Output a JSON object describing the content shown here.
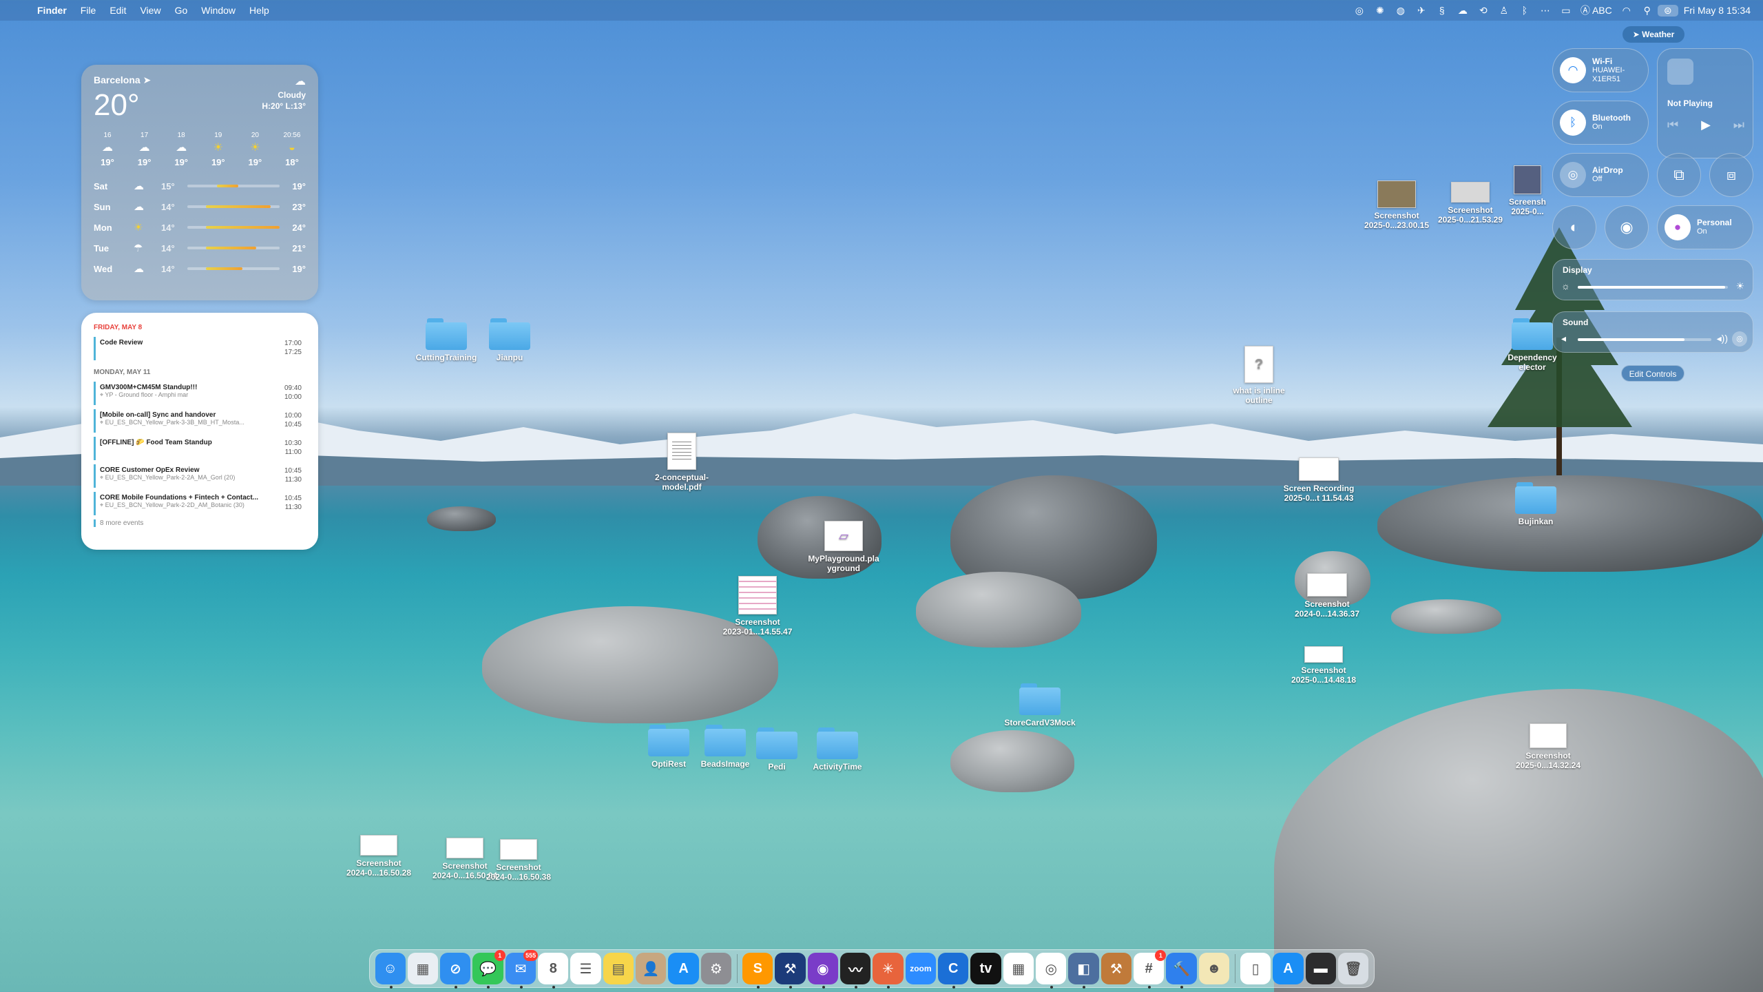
{
  "menubar": {
    "app_name": "Finder",
    "menus": [
      "File",
      "Edit",
      "View",
      "Go",
      "Window",
      "Help"
    ],
    "status_icons": [
      "grammarly-icon",
      "sun-icon",
      "globe-icon",
      "airplane-icon",
      "scribble-icon",
      "cloud-icon",
      "sync-icon",
      "person-icon",
      "bluetooth-icon",
      "dots-icon",
      "battery-icon"
    ],
    "input_source": "ABC",
    "clock": "Fri May 8  15:34"
  },
  "weather": {
    "city": "Barcelona",
    "temp": "20°",
    "condition": "Cloudy",
    "hilo": "H:20° L:13°",
    "hours": [
      {
        "time": "16",
        "icon": "cloud",
        "temp": "19°"
      },
      {
        "time": "17",
        "icon": "cloud",
        "temp": "19°"
      },
      {
        "time": "18",
        "icon": "cloud",
        "temp": "19°"
      },
      {
        "time": "19",
        "icon": "sun",
        "temp": "19°"
      },
      {
        "time": "20",
        "icon": "sun",
        "temp": "19°"
      },
      {
        "time": "20:56",
        "icon": "sunset",
        "temp": "18°"
      }
    ],
    "days": [
      {
        "name": "Sat",
        "icon": "cloud",
        "lo": "15°",
        "hi": "19°",
        "bar": [
          0.32,
          0.55
        ]
      },
      {
        "name": "Sun",
        "icon": "cloud",
        "lo": "14°",
        "hi": "23°",
        "bar": [
          0.2,
          0.9
        ]
      },
      {
        "name": "Mon",
        "icon": "sun",
        "lo": "14°",
        "hi": "24°",
        "bar": [
          0.2,
          1.0
        ]
      },
      {
        "name": "Tue",
        "icon": "rain",
        "lo": "14°",
        "hi": "21°",
        "bar": [
          0.2,
          0.75
        ]
      },
      {
        "name": "Wed",
        "icon": "cloud",
        "lo": "14°",
        "hi": "19°",
        "bar": [
          0.2,
          0.6
        ]
      }
    ]
  },
  "calendar": {
    "today_header": "FRIDAY, MAY 8",
    "today_events": [
      {
        "title": "Code Review",
        "loc": "",
        "start": "17:00",
        "end": "17:25"
      }
    ],
    "next_header": "MONDAY, MAY 11",
    "next_events": [
      {
        "title": "GMV300M+CM45M Standup!!!",
        "loc": "YP - Ground floor - Amphi mar",
        "start": "09:40",
        "end": "10:00"
      },
      {
        "title": "[Mobile on-call] Sync and handover",
        "loc": "EU_ES_BCN_Yellow_Park-3-3B_MB_HT_Mosta...",
        "start": "10:00",
        "end": "10:45"
      },
      {
        "title": "[OFFLINE] 🌮 Food Team Standup",
        "loc": "",
        "start": "10:30",
        "end": "11:00"
      },
      {
        "title": "CORE Customer OpEx Review",
        "loc": "EU_ES_BCN_Yellow_Park-2-2A_MA_Gorl (20)",
        "start": "10:45",
        "end": "11:30"
      },
      {
        "title": "CORE Mobile Foundations + Fintech + Contact...",
        "loc": "EU_ES_BCN_Yellow_Park-2-2D_AM_Botanic (30)",
        "start": "10:45",
        "end": "11:30"
      }
    ],
    "more": "8 more events"
  },
  "desktop": {
    "cutting_training": "CuttingTraining",
    "jianpu": "Jianpu",
    "conceptual_pdf": "2-conceptual-\nmodel.pdf",
    "myplayground": "MyPlayground.pla\nyground",
    "shot_2023": "Screenshot\n2023-01...14.55.47",
    "optirest": "OptiRest",
    "beadsimage": "BeadsImage",
    "pedi": "Pedi",
    "activitytime": "ActivityTime",
    "storecard": "StoreCardV3Mock",
    "shot_a": "Screenshot\n2024-0...16.50.28",
    "shot_b": "Screenshot\n2024-0...16.50.04",
    "shot_c": "Screenshot\n2024-0...16.50.38",
    "inline_outline": "what is inline\noutline",
    "screen_recording": "Screen Recording\n2025-0...t 11.54.43",
    "shot_d": "Screenshot\n2024-0...14.36.37",
    "shot_e": "Screenshot\n2025-0...14.48.18",
    "shot_f": "Screenshot\n2025-0...14.32.24",
    "shot_g": "Screenshot\n2025-0...23.00.15",
    "shot_h": "Screenshot\n2025-0...21.53.29",
    "shot_i": "Screensh\n2025-0...",
    "bujinkan": "Bujinkan",
    "dependency": "Dependency\nelector"
  },
  "control_center": {
    "weather_pill": "Weather",
    "wifi_title": "Wi-Fi",
    "wifi_sub": "HUAWEI-\nX1ER51",
    "bt_title": "Bluetooth",
    "bt_sub": "On",
    "airdrop_title": "AirDrop",
    "airdrop_sub": "Off",
    "personal_title": "Personal",
    "personal_sub": "On",
    "now_playing": "Not Playing",
    "display_label": "Display",
    "display_level": 0.98,
    "sound_label": "Sound",
    "sound_level": 0.8,
    "edit_controls": "Edit Controls"
  },
  "dock": {
    "apps": [
      {
        "name": "Finder",
        "icon": "finder-icon",
        "color": "#2f8ff0",
        "glyph": "☺",
        "running": true
      },
      {
        "name": "Launchpad",
        "icon": "launchpad-icon",
        "color": "#e9eef3",
        "glyph": "▦",
        "running": false
      },
      {
        "name": "Safari",
        "icon": "safari-icon",
        "color": "#2f8ff0",
        "glyph": "⊘",
        "running": true
      },
      {
        "name": "Messages",
        "icon": "messages-icon",
        "color": "#34c759",
        "glyph": "💬",
        "running": true,
        "badge": "1"
      },
      {
        "name": "Mail",
        "icon": "mail-icon",
        "color": "#3a8df2",
        "glyph": "✉",
        "running": true,
        "badge": "555"
      },
      {
        "name": "Calendar",
        "icon": "calendar-icon",
        "color": "#ffffff",
        "glyph": "8",
        "running": true
      },
      {
        "name": "Reminders",
        "icon": "reminders-icon",
        "color": "#ffffff",
        "glyph": "☰",
        "running": false
      },
      {
        "name": "Notes",
        "icon": "notes-icon",
        "color": "#f7d54a",
        "glyph": "▤",
        "running": false
      },
      {
        "name": "Contacts",
        "icon": "contacts-icon",
        "color": "#c7a780",
        "glyph": "👤",
        "running": false
      },
      {
        "name": "App Store",
        "icon": "appstore-icon",
        "color": "#1a8ef5",
        "glyph": "A",
        "running": false
      },
      {
        "name": "System Settings",
        "icon": "settings-icon",
        "color": "#8e8e93",
        "glyph": "⚙",
        "running": false
      },
      {
        "sep": true
      },
      {
        "name": "Sublime Text",
        "icon": "sublime-icon",
        "color": "#ff9800",
        "glyph": "S",
        "running": true
      },
      {
        "name": "Xcode",
        "icon": "xcode-icon",
        "color": "#1c3b7a",
        "glyph": "⚒",
        "running": true
      },
      {
        "name": "GitHub Desktop",
        "icon": "github-icon",
        "color": "#7a3cc8",
        "glyph": "◉",
        "running": true
      },
      {
        "name": "Activity Monitor",
        "icon": "activity-monitor-icon",
        "color": "#222222",
        "glyph": "〰",
        "running": true
      },
      {
        "name": "Claude",
        "icon": "claude-icon",
        "color": "#e8643c",
        "glyph": "✳",
        "running": true
      },
      {
        "name": "Zoom",
        "icon": "zoom-icon",
        "color": "#2d8cff",
        "glyph": "zoom",
        "running": false
      },
      {
        "name": "Proxyman",
        "icon": "proxyman-icon",
        "color": "#1b6fd6",
        "glyph": "C",
        "running": true
      },
      {
        "name": "Apple TV",
        "icon": "appletv-icon",
        "color": "#111111",
        "glyph": "tv",
        "running": false
      },
      {
        "name": "Numbers",
        "icon": "spreadsheet-icon",
        "color": "#ffffff",
        "glyph": "▦",
        "running": false
      },
      {
        "name": "Chrome",
        "icon": "chrome-icon",
        "color": "#ffffff",
        "glyph": "◎",
        "running": true
      },
      {
        "name": "Simulator",
        "icon": "simulator-icon",
        "color": "#4d6f9f",
        "glyph": "◧",
        "running": true
      },
      {
        "name": "Hammer",
        "icon": "toolbox-icon",
        "color": "#c07a3a",
        "glyph": "⚒",
        "running": false
      },
      {
        "name": "Slack",
        "icon": "slack-icon",
        "color": "#ffffff",
        "glyph": "#",
        "running": true,
        "badge": "1"
      },
      {
        "name": "Xcode Instruments",
        "icon": "instruments-icon",
        "color": "#2f80ed",
        "glyph": "🔨",
        "running": true
      },
      {
        "name": "Preview",
        "icon": "preview-icon",
        "color": "#f3e7b6",
        "glyph": "☻",
        "running": false
      },
      {
        "sep": true
      },
      {
        "name": "Document",
        "icon": "document-icon",
        "color": "#ffffff",
        "glyph": "▯",
        "running": false
      },
      {
        "name": "Applications",
        "icon": "applications-folder-icon",
        "color": "#1a8ef5",
        "glyph": "A",
        "running": false
      },
      {
        "name": "Window",
        "icon": "window-icon",
        "color": "#2c2c2e",
        "glyph": "▬",
        "running": false
      },
      {
        "name": "Trash",
        "icon": "trash-icon",
        "color": "#d7dde3",
        "glyph": "🗑",
        "running": false
      }
    ]
  }
}
